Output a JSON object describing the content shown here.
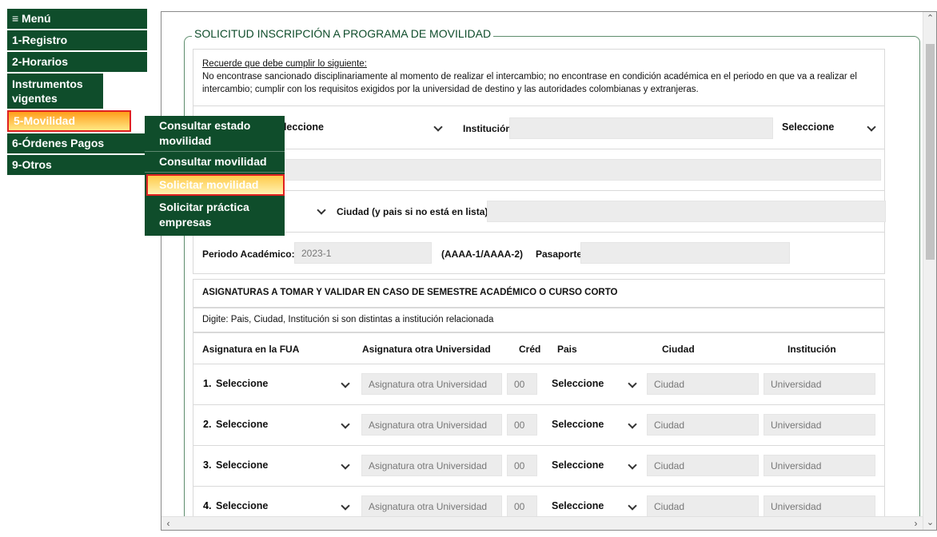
{
  "menu": {
    "items": [
      {
        "label": "≡ Menú"
      },
      {
        "label": "1-Registro"
      },
      {
        "label": "2-Horarios"
      },
      {
        "label": "Instrumentos vigentes"
      },
      {
        "label": "5-Movilidad"
      },
      {
        "label": "6-Órdenes Pagos"
      },
      {
        "label": "9-Otros"
      }
    ],
    "submenu": [
      {
        "label": "Consultar estado movilidad"
      },
      {
        "label": "Consultar movilidad"
      },
      {
        "label": "Solicitar movilidad"
      },
      {
        "label": "Solicitar práctica empresas"
      }
    ],
    "active_color": "#ff9d1a",
    "menu_bg": "#0f4d2b"
  },
  "form": {
    "legend": "SOLICITUD INSCRIPCIÓN A PROGRAMA DE MOVILIDAD",
    "req_title": "Recuerde que debe cumplir lo siguiente:",
    "req_text": "No encontrase sancionado disciplinariamente al momento de realizar el intercambio; no encontrase en condición académica en el periodo en que va a realizar el intercambio; cumplir con los requisitos exigidos por la universidad de destino y las autoridades colombianas y extranjeras.",
    "row1": {
      "select1": "eleccione",
      "institucion_label": "Institución:",
      "select2": "Seleccione"
    },
    "row3": {
      "ciudad_label": "Ciudad (y pais si no está en lista):"
    },
    "row4": {
      "periodo_label": "Periodo Académico:",
      "periodo_value": "2023-1",
      "format_label": "(AAAA-1/AAAA-2)",
      "pasaporte_label": "Pasaporte:"
    },
    "asig_title": "ASIGNATURAS A TOMAR Y VALIDAR EN CASO DE SEMESTRE ACADÉMICO O CURSO CORTO",
    "digite": "Digite: Pais,  Ciudad,  Institución si son distintas a institución relacionada",
    "columns": [
      "Asignatura en la FUA",
      "Asignatura otra Universidad",
      "Créd",
      "Pais",
      "Ciudad",
      "Institución"
    ],
    "rows": [
      {
        "num": "1.",
        "asig": "Seleccione",
        "otra": "Asignatura otra Universidad",
        "cred": "00",
        "pais": "Seleccione",
        "ciudad": "Ciudad",
        "inst": "Universidad"
      },
      {
        "num": "2.",
        "asig": "Seleccione",
        "otra": "Asignatura otra Universidad",
        "cred": "00",
        "pais": "Seleccione",
        "ciudad": "Ciudad",
        "inst": "Universidad"
      },
      {
        "num": "3.",
        "asig": "Seleccione",
        "otra": "Asignatura otra Universidad",
        "cred": "00",
        "pais": "Seleccione",
        "ciudad": "Ciudad",
        "inst": "Universidad"
      },
      {
        "num": "4.",
        "asig": "Seleccione",
        "otra": "Asignatura otra Universidad",
        "cred": "00",
        "pais": "Seleccione",
        "ciudad": "Ciudad",
        "inst": "Universidad"
      }
    ]
  }
}
